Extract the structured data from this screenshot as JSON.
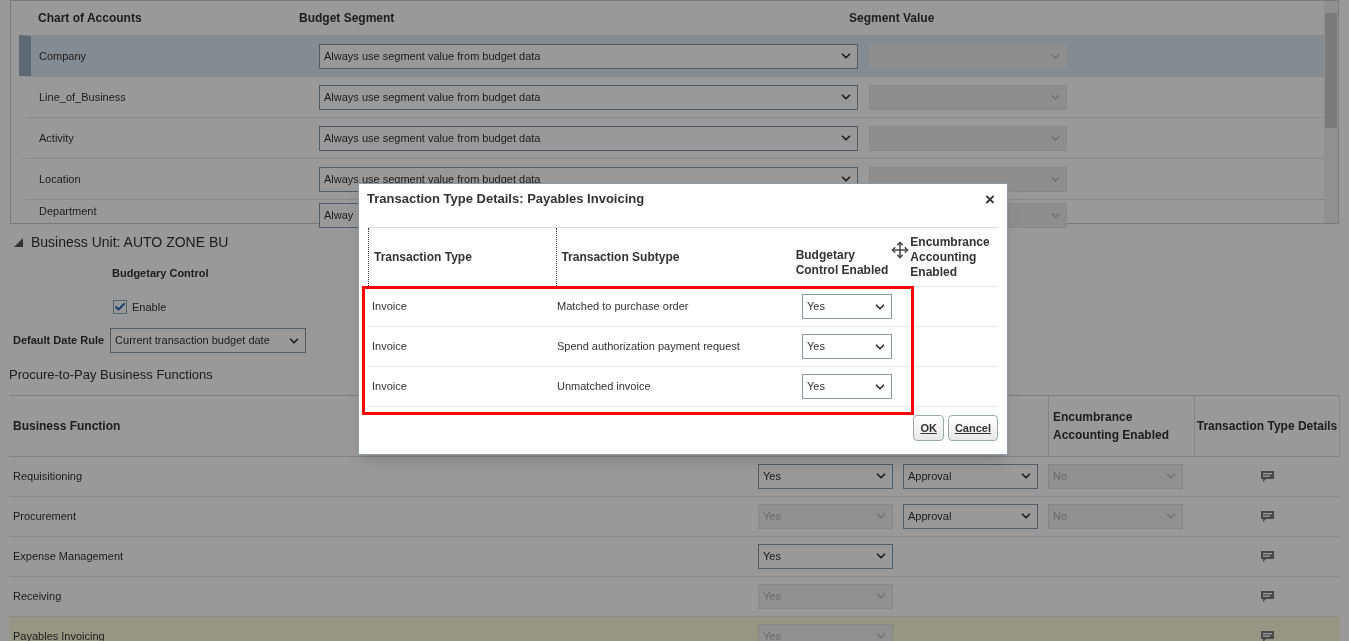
{
  "segments_table": {
    "columns": [
      "Chart of Accounts",
      "Budget Segment",
      "Segment Value"
    ],
    "rows": [
      {
        "account": "Company",
        "budget_segment": "Always use segment value from budget data",
        "selected": true
      },
      {
        "account": "Line_of_Business",
        "budget_segment": "Always use segment value from budget data",
        "selected": false
      },
      {
        "account": "Activity",
        "budget_segment": "Always use segment value from budget data",
        "selected": false
      },
      {
        "account": "Location",
        "budget_segment": "Always use segment value from budget data",
        "selected": false
      },
      {
        "account": "Department",
        "budget_segment": "Alway",
        "selected": false
      }
    ]
  },
  "business_unit": {
    "title": "Business Unit: AUTO ZONE BU",
    "expanded": true,
    "budgetary_control_label": "Budgetary Control",
    "enable": {
      "label": "Enable",
      "checked": true
    },
    "date_rule": {
      "label": "Default Date Rule",
      "value": "Current transaction budget date"
    }
  },
  "functions_table": {
    "title": "Procure-to-Pay Business Functions",
    "columns": [
      "Business Function",
      "Encumbrance Accounting Enabled",
      "Transaction Type Details"
    ],
    "rows": [
      {
        "name": "Requisitioning",
        "selected": false,
        "budgetary": {
          "value": "Yes",
          "disabled": false
        },
        "control": {
          "value": "Approval",
          "disabled": false
        },
        "encumbrance": {
          "value": "No",
          "disabled": true
        }
      },
      {
        "name": "Procurement",
        "selected": false,
        "budgetary": {
          "value": "Yes",
          "disabled": true
        },
        "control": {
          "value": "Approval",
          "disabled": false
        },
        "encumbrance": {
          "value": "No",
          "disabled": true
        }
      },
      {
        "name": "Expense Management",
        "selected": false,
        "budgetary": {
          "value": "Yes",
          "disabled": false
        }
      },
      {
        "name": "Receiving",
        "selected": false,
        "budgetary": {
          "value": "Yes",
          "disabled": true
        }
      },
      {
        "name": "Payables Invoicing",
        "selected": true,
        "budgetary": {
          "value": "Yes",
          "disabled": true
        }
      }
    ]
  },
  "dialog": {
    "title": "Transaction Type Details: Payables Invoicing",
    "close": "×",
    "columns": [
      "Transaction Type",
      "Transaction Subtype",
      "Budgetary Control Enabled",
      "Encumbrance Accounting Enabled"
    ],
    "rows": [
      {
        "type": "Invoice",
        "subtype": "Matched to purchase order",
        "budgetary": "Yes"
      },
      {
        "type": "Invoice",
        "subtype": "Spend authorization payment request",
        "budgetary": "Yes"
      },
      {
        "type": "Invoice",
        "subtype": "Unmatched invoice",
        "budgetary": "Yes"
      }
    ],
    "buttons": [
      "OK",
      "Cancel"
    ]
  }
}
